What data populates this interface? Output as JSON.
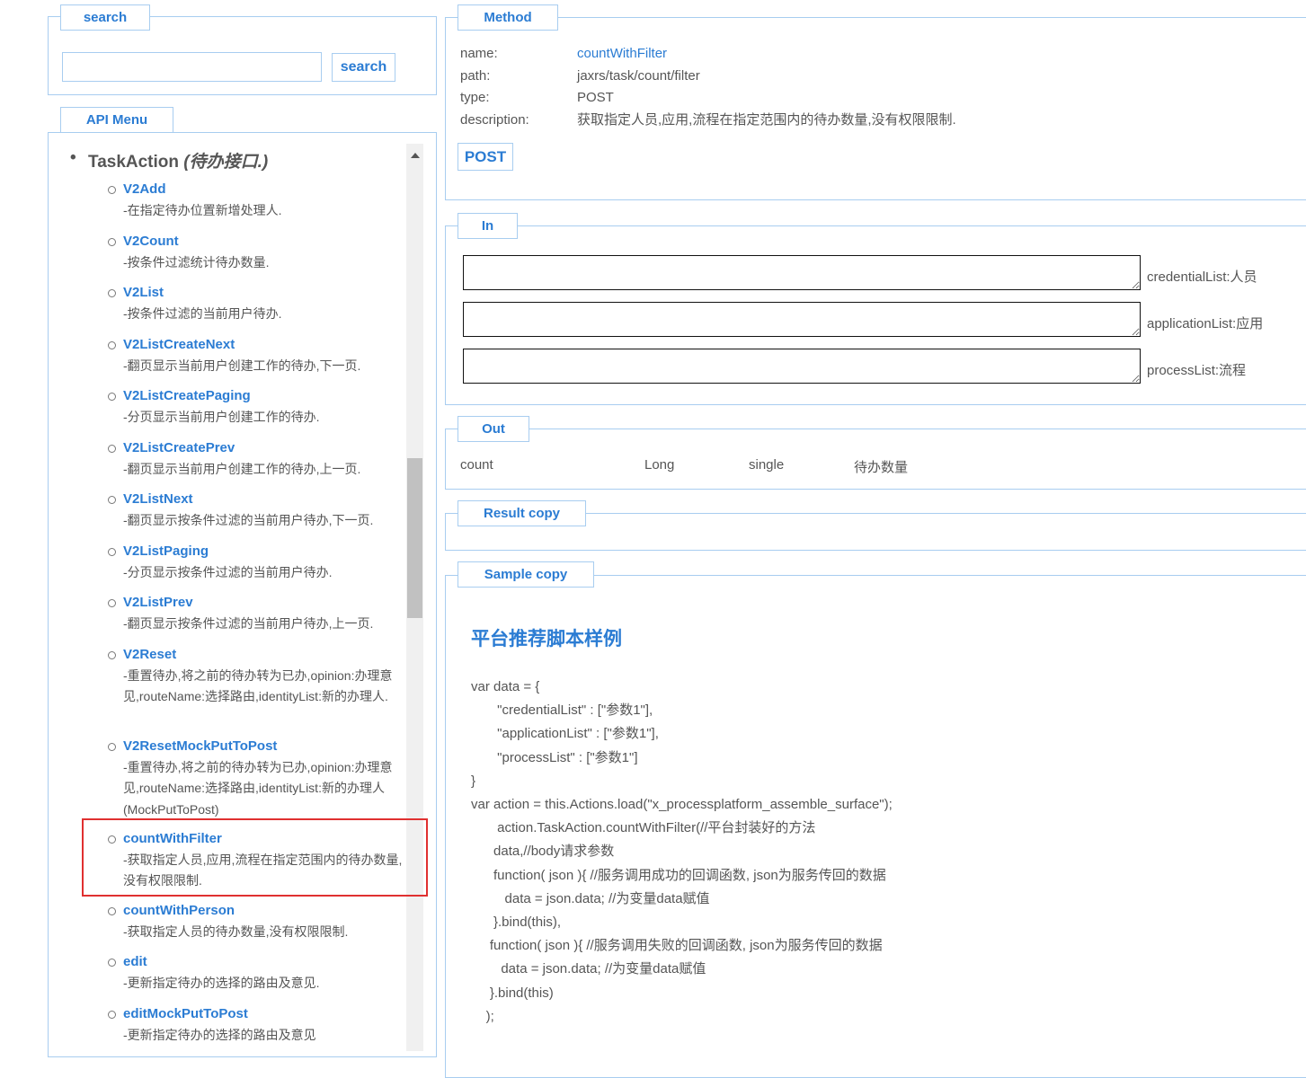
{
  "search": {
    "legend": "search",
    "input_value": "",
    "button": "search"
  },
  "menu": {
    "legend": "API Menu",
    "group": "TaskAction",
    "group_desc": "(待办接口.)",
    "items": [
      {
        "name": "V2Add",
        "desc": "-在指定待办位置新增处理人."
      },
      {
        "name": "V2Count",
        "desc": "-按条件过滤统计待办数量."
      },
      {
        "name": "V2List",
        "desc": "-按条件过滤的当前用户待办."
      },
      {
        "name": "V2ListCreateNext",
        "desc": "-翻页显示当前用户创建工作的待办,下一页."
      },
      {
        "name": "V2ListCreatePaging",
        "desc": "-分页显示当前用户创建工作的待办."
      },
      {
        "name": "V2ListCreatePrev",
        "desc": "-翻页显示当前用户创建工作的待办,上一页."
      },
      {
        "name": "V2ListNext",
        "desc": "-翻页显示按条件过滤的当前用户待办,下一页."
      },
      {
        "name": "V2ListPaging",
        "desc": "-分页显示按条件过滤的当前用户待办."
      },
      {
        "name": "V2ListPrev",
        "desc": "-翻页显示按条件过滤的当前用户待办,上一页."
      },
      {
        "name": "V2Reset",
        "desc": "-重置待办,将之前的待办转为已办,opinion:办理意见,routeName:选择路由,identityList:新的办理人."
      },
      {
        "name": "V2ResetMockPutToPost",
        "desc": "-重置待办,将之前的待办转为已办,opinion:办理意见,routeName:选择路由,identityList:新的办理人(MockPutToPost)"
      },
      {
        "name": "countWithFilter",
        "desc": "-获取指定人员,应用,流程在指定范围内的待办数量,没有权限限制."
      },
      {
        "name": "countWithPerson",
        "desc": "-获取指定人员的待办数量,没有权限限制."
      },
      {
        "name": "edit",
        "desc": "-更新指定待办的选择的路由及意见."
      },
      {
        "name": "editMockPutToPost",
        "desc": "-更新指定待办的选择的路由及意见"
      }
    ]
  },
  "method": {
    "legend": "Method",
    "name_label": "name:",
    "name": "countWithFilter",
    "path_label": "path:",
    "path": "jaxrs/task/count/filter",
    "type_label": "type:",
    "type": "POST",
    "desc_label": "description:",
    "desc": "获取指定人员,应用,流程在指定范围内的待办数量,没有权限限制.",
    "button": "POST"
  },
  "in": {
    "legend": "In",
    "params": [
      {
        "label": "credentialList:人员",
        "value": ""
      },
      {
        "label": "applicationList:应用",
        "value": ""
      },
      {
        "label": "processList:流程",
        "value": ""
      }
    ]
  },
  "out": {
    "legend": "Out",
    "row": [
      "count",
      "Long",
      "single",
      "待办数量"
    ]
  },
  "result": {
    "legend": "Result copy"
  },
  "sample": {
    "legend": "Sample copy",
    "title": "平台推荐脚本样例",
    "code": "var data = {\n       \"credentialList\" : [\"参数1\"],\n       \"applicationList\" : [\"参数1\"],\n       \"processList\" : [\"参数1\"]\n}\nvar action = this.Actions.load(\"x_processplatform_assemble_surface\");\n       action.TaskAction.countWithFilter(//平台封装好的方法\n      data,//body请求参数\n      function( json ){ //服务调用成功的回调函数, json为服务传回的数据\n         data = json.data; //为变量data赋值\n      }.bind(this),\n     function( json ){ //服务调用失败的回调函数, json为服务传回的数据\n        data = json.data; //为变量data赋值\n     }.bind(this)\n    );"
  },
  "colors": {
    "accent": "#2b7cd3",
    "border": "#a8cdf0",
    "highlight": "#e03030"
  }
}
